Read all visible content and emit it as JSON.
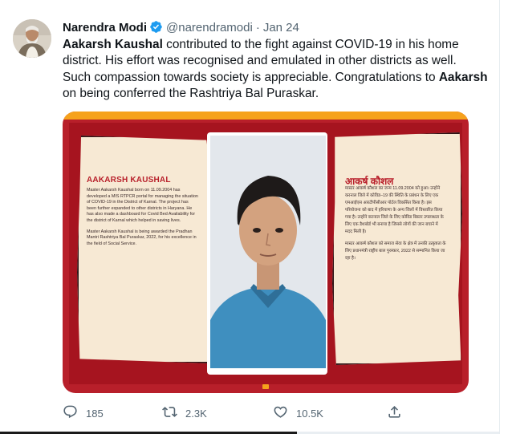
{
  "tweet": {
    "author": {
      "display_name": "Narendra Modi",
      "handle": "@narendramodi",
      "separator": "·",
      "date": "Jan 24",
      "verified": true
    },
    "text": {
      "p1_bold": "Aakarsh Kaushal",
      "p1_rest": " contributed to the fight against COVID-19 in his home district. His effort was recognised and emulated in other districts as well. Such compassion towards society is appreciable. Congratulations to ",
      "p2_bold": "Aakarsh",
      "p2_rest": " on being conferred the Rashtriya Bal Puraskar."
    },
    "media": {
      "title_en": "AAKARSH KAUSHAL",
      "text_en_1": "Master Aakarsh Kaushal born on 11.09.2004 has developed a MIS RTPCR portal for managing the situation of COVID-19 in the District of Karnal. The project has been further expanded to other districts in Haryana. He has also made a dashboard for Covid Bed Availability for the district of Karnal which helped in saving lives.",
      "text_en_2": "Master Aakarsh Kaushal is being awarded the Pradhan Mantri Rashtriya Bal Puraskar, 2022, for his excellence in the field of Social Service.",
      "title_hi": "आकर्ष कौशल",
      "text_hi_1": "मास्टर आकर्ष कौशल का जन्म 11.09.2004 को हुआ। उन्होंने करनाल जिले में कोविड–19 की स्थिति के प्रबंधन के लिए एक एमआईएस आरटीपीसीआर पोर्टल विकसित किया है। इस परियोजना को बाद में हरियाणा के अन्य जिलों में विस्तारित किया गया है। उन्होंने करनाल जिले के लिए कोविड बिस्तर उपलब्धता के लिए एक डैशबोर्ड भी बनाया है जिससे लोगों की जान बचाने में मदद मिली है।",
      "text_hi_2": "मास्टर आकर्ष कौशल को समाज सेवा के क्षेत्र में उनकी उत्कृष्टता के लिए प्रधानमंत्री राष्ट्रीय बाल पुरस्कार, 2022 से सम्मानित किया जा रहा है।"
    },
    "actions": {
      "reply": {
        "icon": "reply-icon",
        "count": "185"
      },
      "retweet": {
        "icon": "retweet-icon",
        "count": "2.3K"
      },
      "like": {
        "icon": "like-icon",
        "count": "10.5K"
      },
      "share": {
        "icon": "share-icon"
      }
    },
    "colors": {
      "verified": "#1d9bf0",
      "muted": "#536471",
      "poster_red": "#b81f2a",
      "poster_cream": "#f7e9d4",
      "poster_orange": "#f6a21c"
    }
  }
}
